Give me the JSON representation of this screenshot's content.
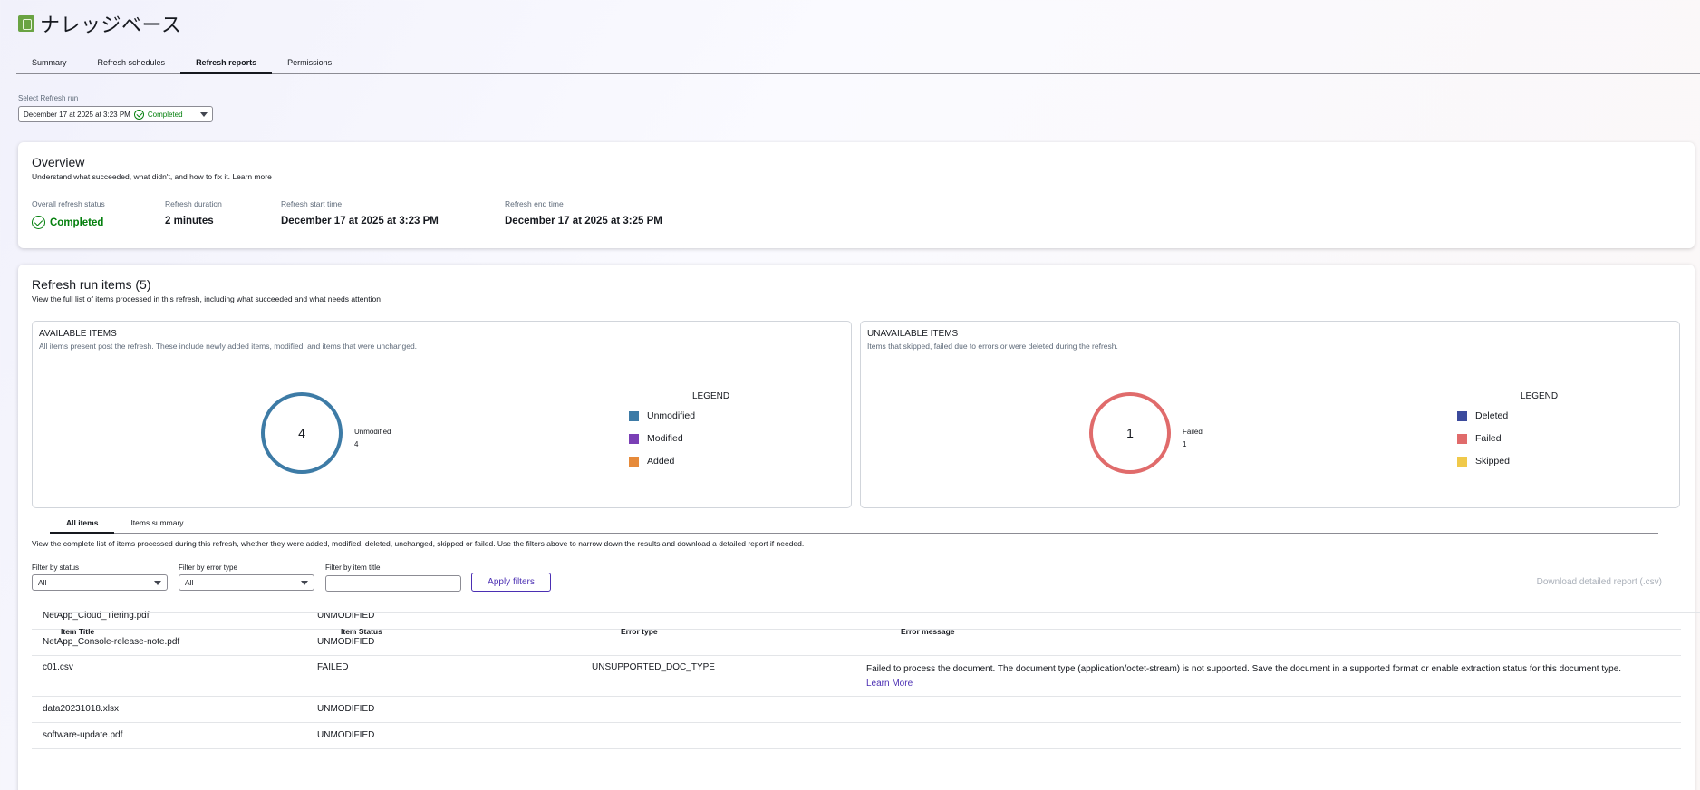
{
  "page": {
    "title": "ナレッジベース"
  },
  "tabs": [
    {
      "label": "Summary"
    },
    {
      "label": "Refresh schedules"
    },
    {
      "label": "Refresh reports"
    },
    {
      "label": "Permissions"
    }
  ],
  "run_selector": {
    "label": "Select Refresh run",
    "value": "December 17 at 2025 at 3:23 PM",
    "status": "Completed"
  },
  "overview": {
    "title": "Overview",
    "description": "Understand what succeeded, what didn't, and how to fix it. Learn more",
    "stats": [
      {
        "label": "Overall refresh status",
        "value": "Completed"
      },
      {
        "label": "Refresh duration",
        "value": "2 minutes"
      },
      {
        "label": "Refresh start time",
        "value": "December 17 at 2025 at 3:23 PM"
      },
      {
        "label": "Refresh end time",
        "value": "December 17 at 2025 at 3:25 PM"
      }
    ]
  },
  "items": {
    "title": "Refresh run items (5)",
    "description": "View the full list of items processed in this refresh, including what succeeded and what needs attention",
    "available": {
      "title": "AVAILABLE ITEMS",
      "description": "All items present post the refresh. These include newly added items, modified, and items that were unchanged.",
      "total": "4",
      "label_name": "Unmodified",
      "label_value": "4",
      "legend_title": "LEGEND",
      "legend": [
        {
          "label": "Unmodified",
          "color": "#3d7ba6"
        },
        {
          "label": "Modified",
          "color": "#7a3fb5"
        },
        {
          "label": "Added",
          "color": "#e68a3a"
        }
      ]
    },
    "unavailable": {
      "title": "UNAVAILABLE ITEMS",
      "description": "Items that skipped, failed due to errors or were deleted during the refresh.",
      "total": "1",
      "label_name": "Failed",
      "label_value": "1",
      "legend_title": "LEGEND",
      "legend": [
        {
          "label": "Deleted",
          "color": "#3b4a9c"
        },
        {
          "label": "Failed",
          "color": "#e06b6b"
        },
        {
          "label": "Skipped",
          "color": "#f0c94a"
        }
      ]
    },
    "subtabs": [
      {
        "label": "All items"
      },
      {
        "label": "Items summary"
      }
    ],
    "list_description": "View the complete list of items processed during this refresh, whether they were added, modified, deleted, unchanged, skipped or failed. Use the filters above to narrow down the results and download a detailed report if needed.",
    "filters": {
      "status_label": "Filter by status",
      "status_value": "All",
      "error_label": "Filter by error type",
      "error_value": "All",
      "title_label": "Filter by item title",
      "title_value": "",
      "apply_label": "Apply filters",
      "download_label": "Download detailed report (.csv)"
    },
    "table": {
      "headers": [
        "Item Title",
        "Item Status",
        "Error type",
        "Error message"
      ],
      "rows": [
        {
          "title": "NetApp_Cloud_Tiering.pdf",
          "status": "UNMODIFIED",
          "error_type": "",
          "error_message": "",
          "link": ""
        },
        {
          "title": "NetApp_Console-release-note.pdf",
          "status": "UNMODIFIED",
          "error_type": "",
          "error_message": "",
          "link": ""
        },
        {
          "title": "c01.csv",
          "status": "FAILED",
          "error_type": "UNSUPPORTED_DOC_TYPE",
          "error_message": "Failed to process the document. The document type (application/octet-stream) is not supported. Save the document in a supported format or enable extraction status for this document type.",
          "link": "Learn More"
        },
        {
          "title": "data20231018.xlsx",
          "status": "UNMODIFIED",
          "error_type": "",
          "error_message": "",
          "link": ""
        },
        {
          "title": "software-update.pdf",
          "status": "UNMODIFIED",
          "error_type": "",
          "error_message": "",
          "link": ""
        }
      ]
    }
  }
}
